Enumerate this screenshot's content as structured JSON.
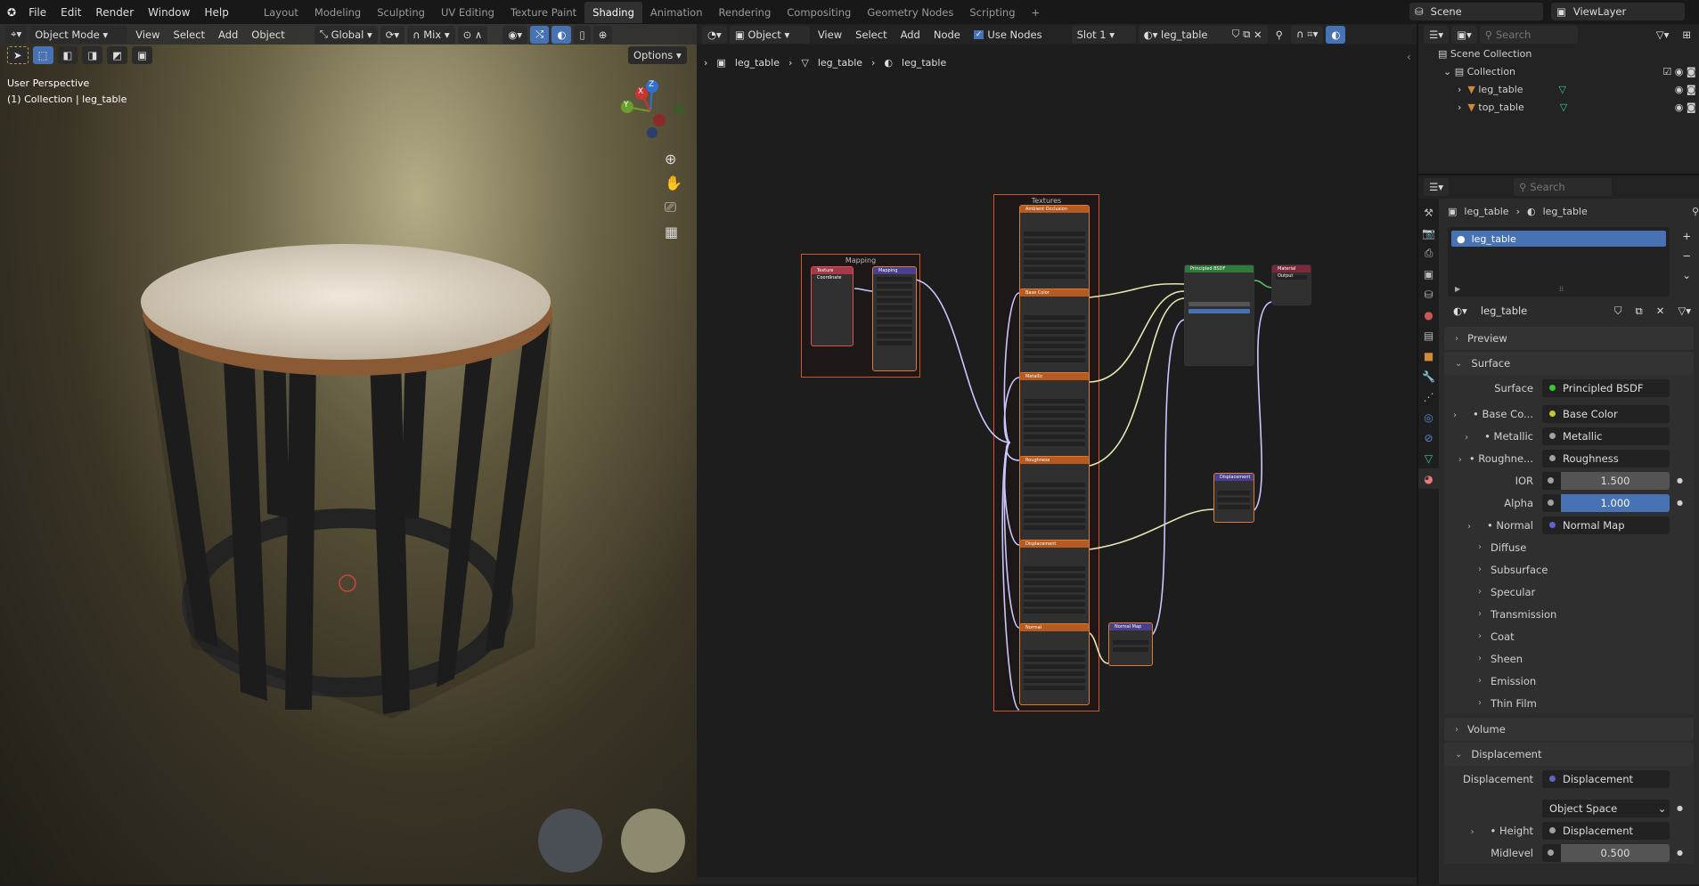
{
  "topbar": {
    "menus": [
      "File",
      "Edit",
      "Render",
      "Window",
      "Help"
    ],
    "workspaces": [
      "Layout",
      "Modeling",
      "Sculpting",
      "UV Editing",
      "Texture Paint",
      "Shading",
      "Animation",
      "Rendering",
      "Compositing",
      "Geometry Nodes",
      "Scripting"
    ],
    "active_workspace": "Shading",
    "add_tab": "+",
    "scene": "Scene",
    "view_layer": "ViewLayer"
  },
  "viewport": {
    "mode": "Object Mode",
    "menus": [
      "View",
      "Select",
      "Add",
      "Object"
    ],
    "orientation": "Global",
    "pivot_blend": "Mix",
    "options": "Options",
    "overlay_title": "User Perspective",
    "overlay_sub": "(1) Collection | leg_table",
    "gizmo": {
      "x": "X",
      "y": "Y",
      "z": "Z"
    }
  },
  "node_editor": {
    "type": "Object",
    "menus": [
      "View",
      "Select",
      "Add",
      "Node"
    ],
    "use_nodes_label": "Use Nodes",
    "use_nodes": true,
    "slot": "Slot 1",
    "material": "leg_table",
    "breadcrumb": [
      "leg_table",
      "leg_table",
      "leg_table"
    ],
    "frames": {
      "mapping": "Mapping",
      "textures": "Textures"
    },
    "nodes": {
      "tex_coord": "Texture Coordinate",
      "mapping": "Mapping",
      "ao": "Ambient Occlusion",
      "base_color": "Base Color",
      "metallic": "Metallic",
      "roughness": "Roughness",
      "displacement_tex": "Displacement",
      "normal_tex": "Normal",
      "bsdf": "Principled BSDF",
      "output": "Material Output",
      "displacement": "Displacement",
      "normal_map": "Normal Map"
    }
  },
  "outliner": {
    "search_placeholder": "Search",
    "scene_collection": "Scene Collection",
    "collection": "Collection",
    "objects": [
      "leg_table",
      "top_table"
    ]
  },
  "properties": {
    "search_placeholder": "Search",
    "breadcrumb": [
      "leg_table",
      "leg_table"
    ],
    "slots": [
      "leg_table"
    ],
    "material": "leg_table",
    "panels": {
      "preview": "Preview",
      "surface": "Surface",
      "volume": "Volume",
      "displacement": "Displacement"
    },
    "surface": {
      "label": "Surface",
      "value": "Principled BSDF",
      "inputs": [
        {
          "label": "Base Co...",
          "value": "Base Color",
          "color": "#c7c729"
        },
        {
          "label": "Metallic",
          "value": "Metallic",
          "color": "#a1a1a1"
        },
        {
          "label": "Roughne...",
          "value": "Roughness",
          "color": "#a1a1a1"
        }
      ],
      "ior_label": "IOR",
      "ior": "1.500",
      "alpha_label": "Alpha",
      "alpha": "1.000",
      "normal_label": "Normal",
      "normal_value": "Normal Map",
      "subpanels": [
        "Diffuse",
        "Subsurface",
        "Specular",
        "Transmission",
        "Coat",
        "Sheen",
        "Emission",
        "Thin Film"
      ]
    },
    "displacement": {
      "label": "Displacement",
      "value": "Displacement",
      "space": "Object Space",
      "height_label": "Height",
      "height_value": "Displacement",
      "midlevel_label": "Midlevel",
      "midlevel": "0.500"
    }
  }
}
